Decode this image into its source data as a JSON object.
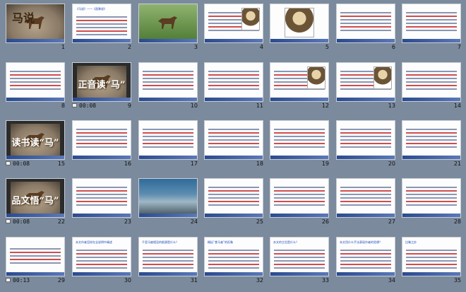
{
  "slides": [
    {
      "n": "1",
      "kind": "title",
      "title": "马说"
    },
    {
      "n": "2",
      "kind": "text",
      "heading": "《马说》——《昌黎说》"
    },
    {
      "n": "3",
      "kind": "photo"
    },
    {
      "n": "4",
      "kind": "text"
    },
    {
      "n": "5",
      "kind": "portrait"
    },
    {
      "n": "6",
      "kind": "text"
    },
    {
      "n": "7",
      "kind": "text"
    },
    {
      "n": "8",
      "kind": "text"
    },
    {
      "n": "9",
      "kind": "video",
      "overlay": "正音读“马”",
      "time": "00:08"
    },
    {
      "n": "10",
      "kind": "text"
    },
    {
      "n": "11",
      "kind": "text"
    },
    {
      "n": "12",
      "kind": "text"
    },
    {
      "n": "13",
      "kind": "text"
    },
    {
      "n": "14",
      "kind": "text"
    },
    {
      "n": "15",
      "kind": "video",
      "overlay": "读书读“马”",
      "time": "00:08"
    },
    {
      "n": "16",
      "kind": "text"
    },
    {
      "n": "17",
      "kind": "text"
    },
    {
      "n": "18",
      "kind": "text"
    },
    {
      "n": "19",
      "kind": "text"
    },
    {
      "n": "20",
      "kind": "text"
    },
    {
      "n": "21",
      "kind": "text"
    },
    {
      "n": "22",
      "kind": "video",
      "overlay": "品文悟“马”",
      "time": "00:08"
    },
    {
      "n": "23",
      "kind": "text"
    },
    {
      "n": "24",
      "kind": "sea"
    },
    {
      "n": "25",
      "kind": "text"
    },
    {
      "n": "26",
      "kind": "text"
    },
    {
      "n": "27",
      "kind": "text"
    },
    {
      "n": "28",
      "kind": "text"
    },
    {
      "n": "29",
      "kind": "video-text",
      "time": "00:13"
    },
    {
      "n": "30",
      "kind": "text",
      "heading": "本文作者怎样在全说明中阐述"
    },
    {
      "n": "31",
      "kind": "text",
      "heading": "千里马被埋没的根源是什么？"
    },
    {
      "n": "32",
      "kind": "text",
      "heading": "概括“食马者”的形象"
    },
    {
      "n": "33",
      "kind": "text",
      "heading": "本文的主旨是什么？"
    },
    {
      "n": "34",
      "kind": "text",
      "heading": "本文用什么手法表现作者的思想？"
    },
    {
      "n": "35",
      "kind": "text",
      "heading": "比喻之妙"
    }
  ]
}
